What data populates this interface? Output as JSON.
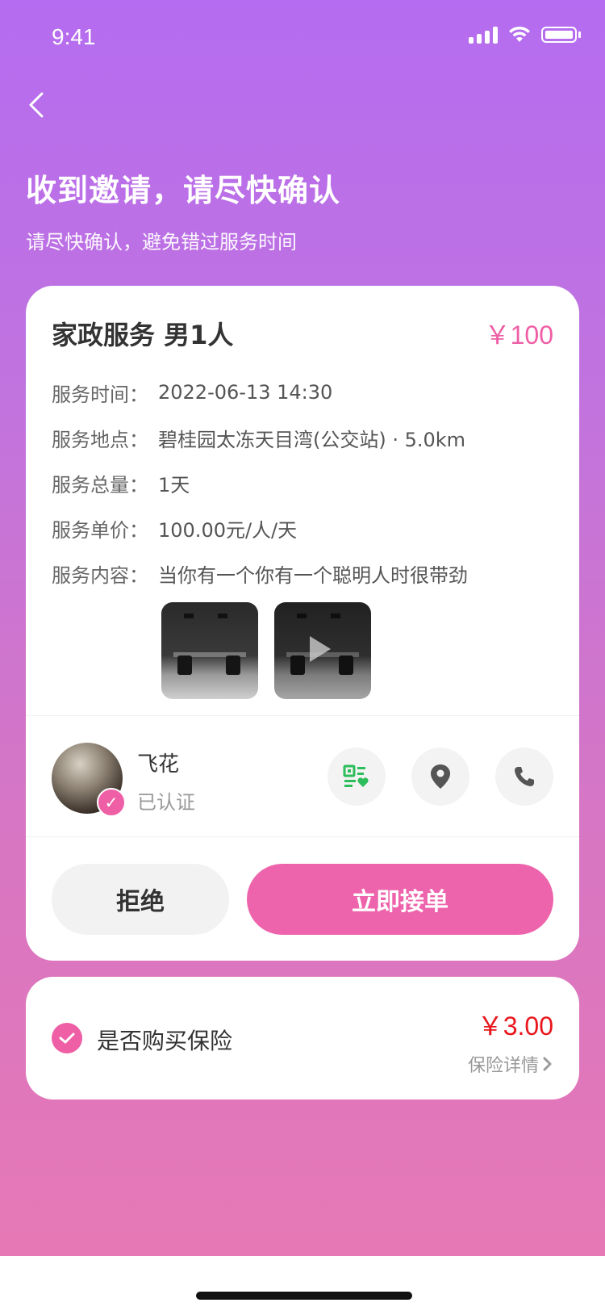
{
  "status_bar": {
    "time": "9:41"
  },
  "header": {
    "title": "收到邀请，请尽快确认",
    "subtitle": "请尽快确认，避免错过服务时间"
  },
  "service": {
    "title": "家政服务 男1人",
    "price": "￥100",
    "rows": [
      {
        "label": "服务时间：",
        "value": "2022-06-13 14:30"
      },
      {
        "label": "服务地点：",
        "value": "碧桂园太冻天目湾(公交站) · 5.0km"
      },
      {
        "label": "服务总量：",
        "value": "1天"
      },
      {
        "label": "服务单价：",
        "value": "100.00元/人/天"
      },
      {
        "label": "服务内容：",
        "value": "当你有一个你有一个聪明人时很带劲"
      }
    ]
  },
  "user": {
    "name": "飞花",
    "status": "已认证"
  },
  "actions": {
    "reject": "拒绝",
    "accept": "立即接单"
  },
  "insurance": {
    "label": "是否购买保险",
    "price": "￥3.00",
    "detail": "保险详情",
    "checked": true
  },
  "colors": {
    "accent": "#ee5fa5",
    "price_red": "#e8161c",
    "icon_green": "#2dbd5a"
  }
}
